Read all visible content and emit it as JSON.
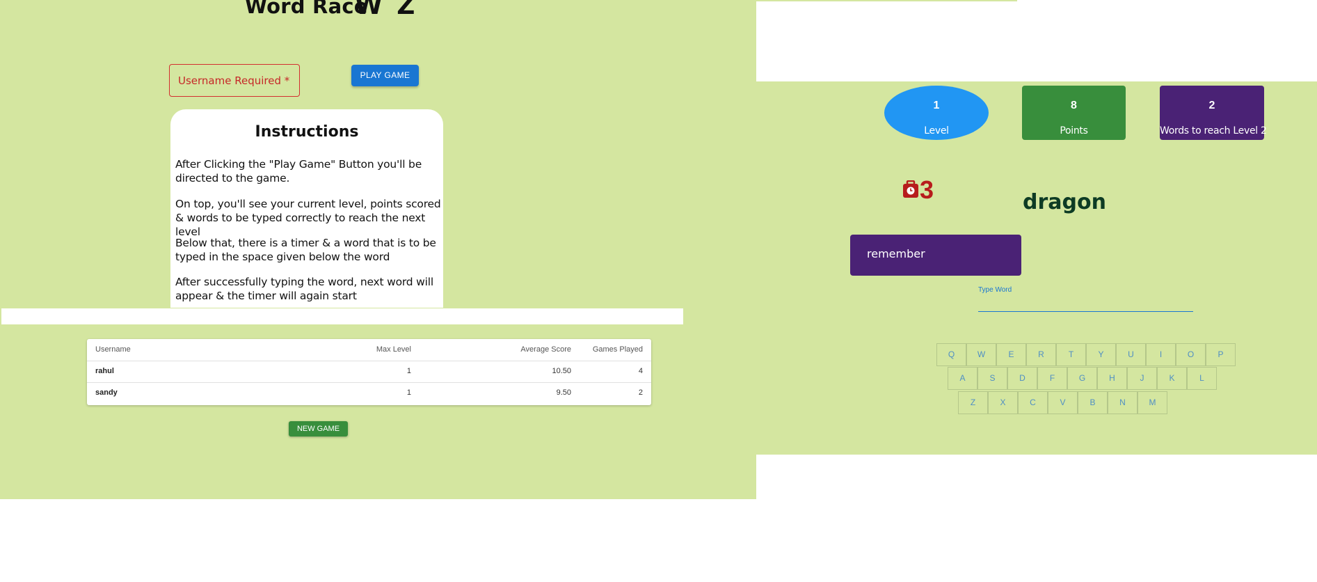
{
  "left": {
    "title": "Word Race",
    "title_clipped": "W  Z",
    "username_placeholder": "Username Required *",
    "play_button": "PLAY GAME",
    "instructions": {
      "title": "Instructions",
      "paragraphs": [
        "After Clicking the \"Play Game\" Button you'll be directed to the game.",
        "On top, you'll see your current level, points scored & words to be typed correctly to reach the next level",
        "Below that, there is a timer & a word that is to be typed in the space given below the word",
        "After successfully typing the word, next word will appear & the timer will again start"
      ]
    },
    "table": {
      "headers": [
        "Username",
        "Max Level",
        "Average Score",
        "Games Played"
      ],
      "rows": [
        [
          "rahul",
          "1",
          "10.50",
          "4"
        ],
        [
          "sandy",
          "1",
          "9.50",
          "2"
        ]
      ]
    },
    "new_game_button": "NEW GAME"
  },
  "right": {
    "stats": {
      "level": {
        "value": "1",
        "label": "Level"
      },
      "points": {
        "value": "8",
        "label": "Points"
      },
      "words": {
        "value": "2",
        "label": "Words to reach Level 2"
      }
    },
    "timer": "3",
    "target_word": "dragon",
    "typed_word": "remember",
    "type_label": "Type Word",
    "keyboard": [
      [
        "Q",
        "W",
        "E",
        "R",
        "T",
        "Y",
        "U",
        "I",
        "O",
        "P"
      ],
      [
        "A",
        "S",
        "D",
        "F",
        "G",
        "H",
        "J",
        "K",
        "L"
      ],
      [
        "Z",
        "X",
        "C",
        "V",
        "B",
        "N",
        "M"
      ]
    ]
  },
  "colors": {
    "background": "#d4e6a0",
    "primary_blue": "#1976d2",
    "level_blue": "#2196f3",
    "green": "#388e3c",
    "purple": "#4a2275",
    "timer_red": "#b71c1c",
    "error_red": "#d32f2f"
  },
  "icons": {
    "timer": "timer-icon"
  }
}
